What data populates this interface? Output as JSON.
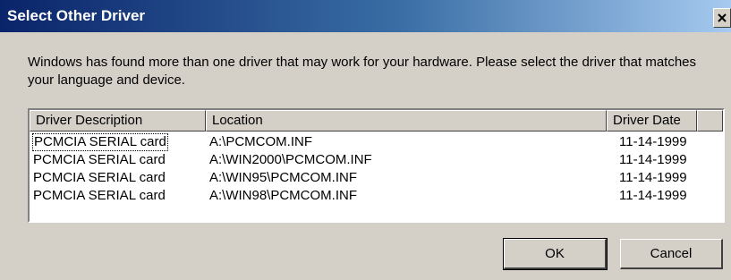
{
  "window": {
    "title": "Select Other Driver",
    "close_icon": "close-icon"
  },
  "message": "Windows has found more than one driver that may work for your hardware.  Please select the driver that matches your language and device.",
  "list": {
    "columns": [
      "Driver Description",
      "Location",
      "Driver Date"
    ],
    "rows": [
      {
        "description": "PCMCIA SERIAL card",
        "location": "A:\\PCMCOM.INF",
        "date": "11-14-1999",
        "selected": true
      },
      {
        "description": "PCMCIA SERIAL card",
        "location": "A:\\WIN2000\\PCMCOM.INF",
        "date": "11-14-1999",
        "selected": false
      },
      {
        "description": "PCMCIA SERIAL card",
        "location": "A:\\WIN95\\PCMCOM.INF",
        "date": "11-14-1999",
        "selected": false
      },
      {
        "description": "PCMCIA SERIAL card",
        "location": "A:\\WIN98\\PCMCOM.INF",
        "date": "11-14-1999",
        "selected": false
      }
    ]
  },
  "buttons": {
    "ok_label": "OK",
    "cancel_label": "Cancel"
  }
}
